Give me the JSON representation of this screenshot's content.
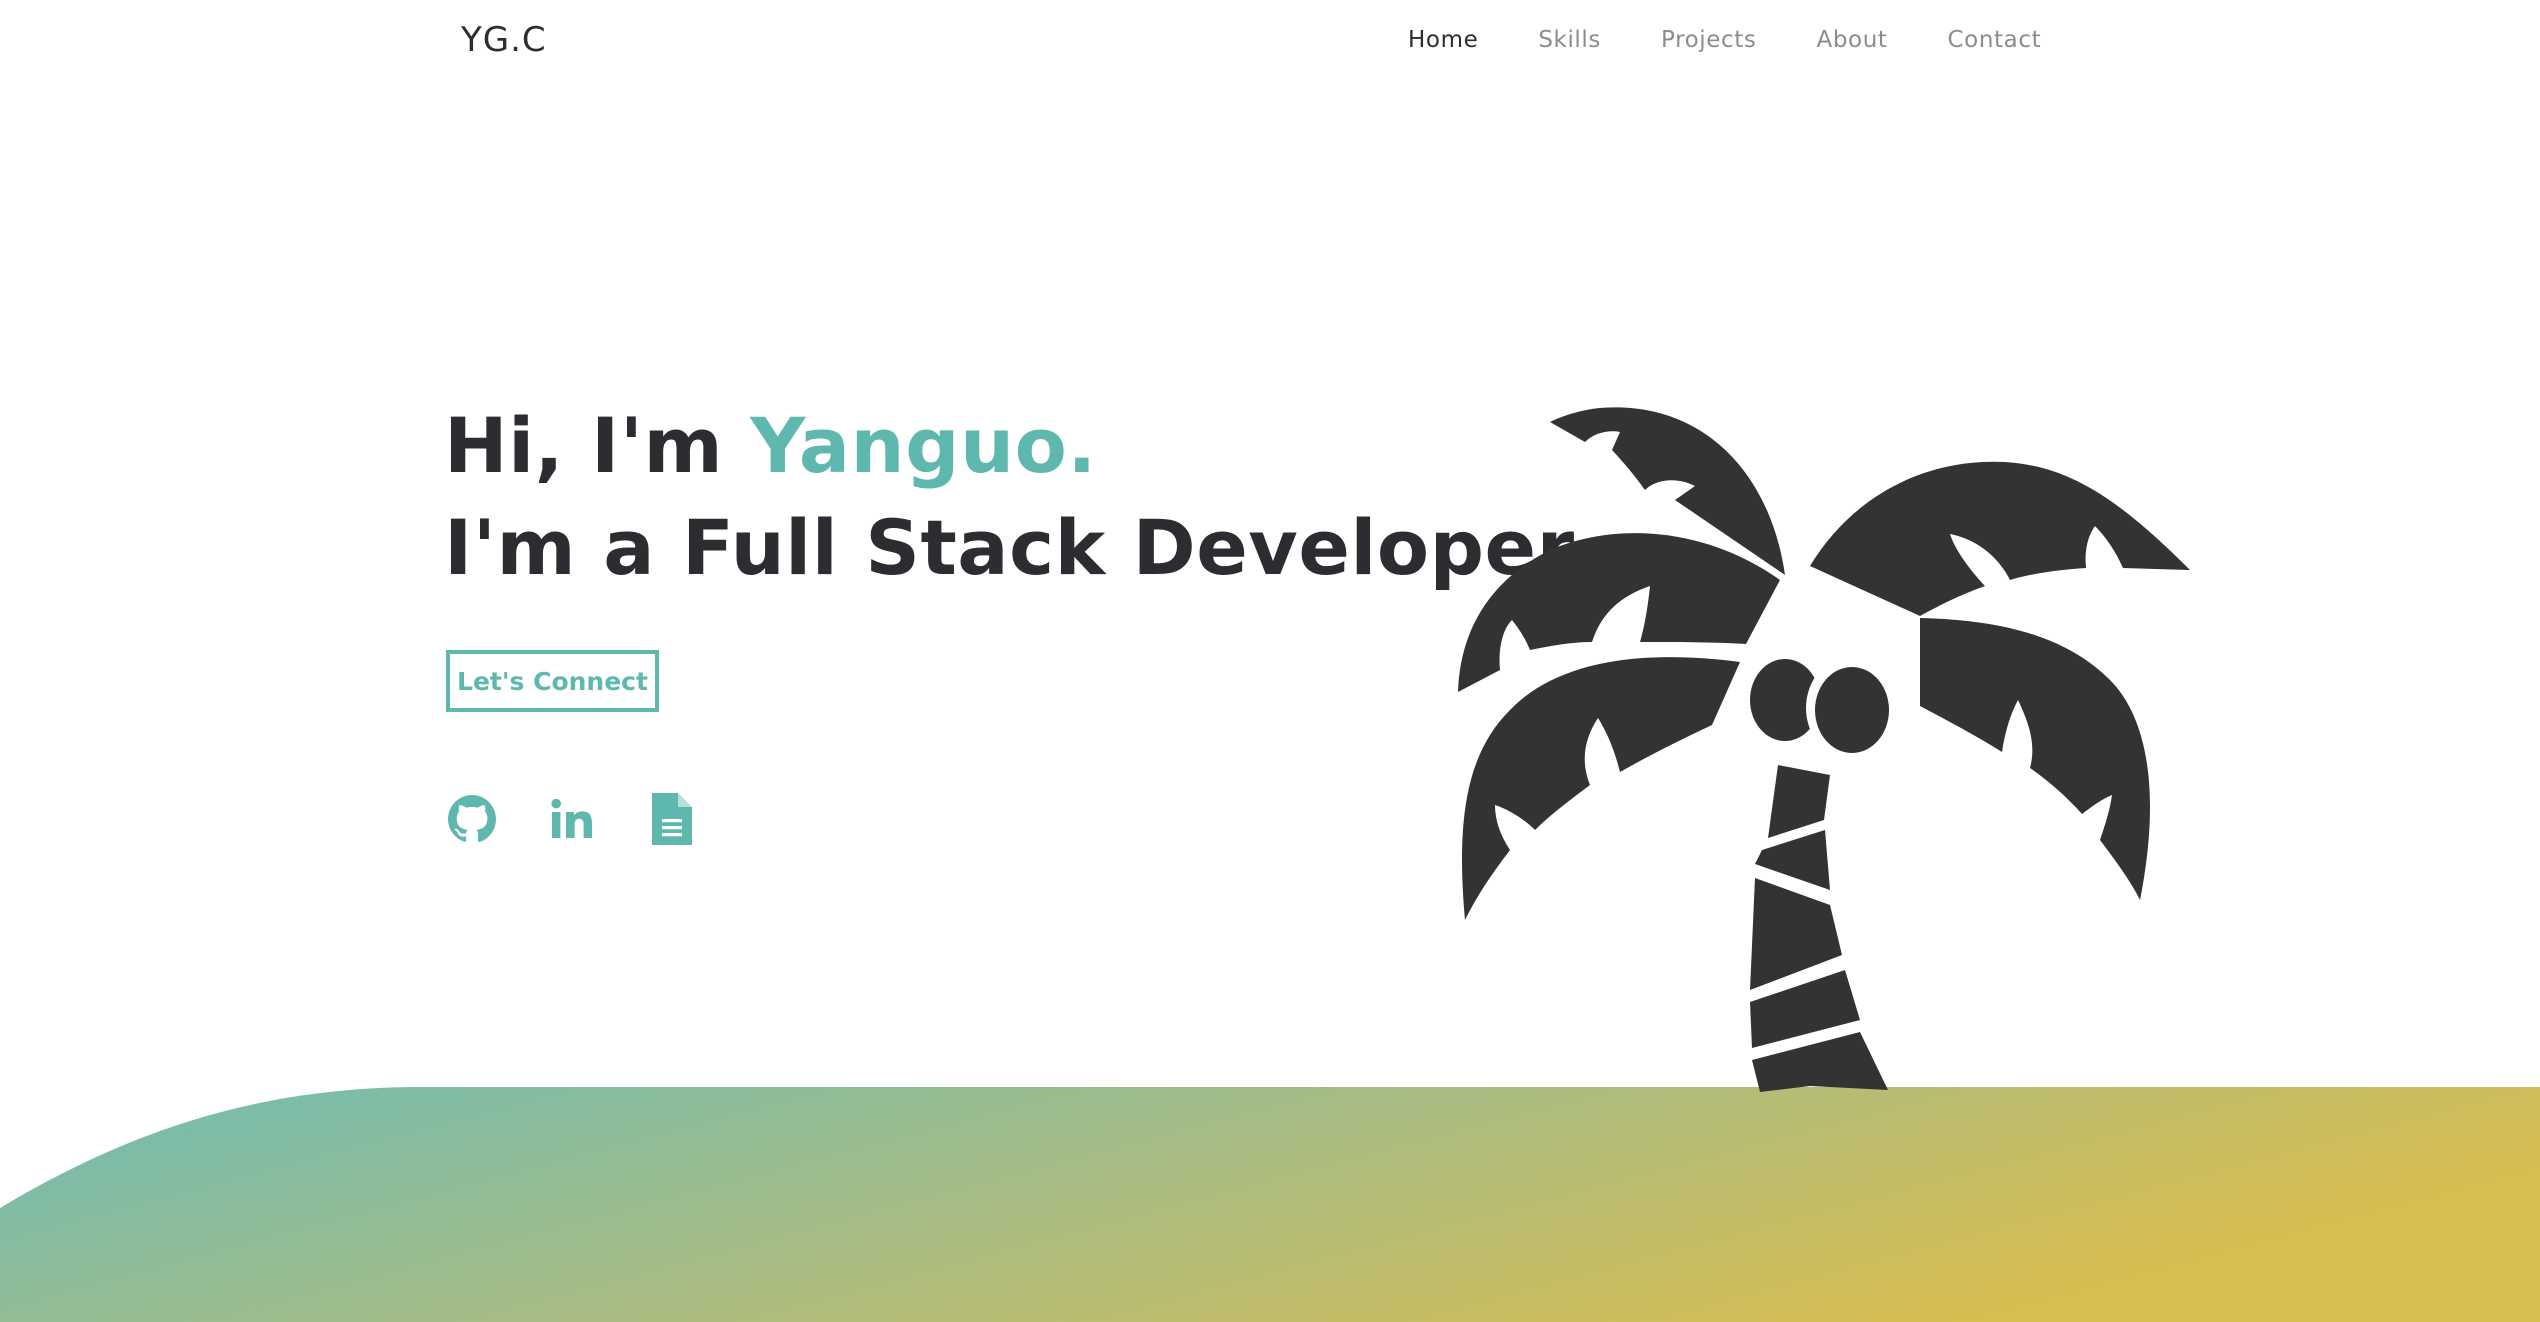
{
  "nav": {
    "logo": "YG.C",
    "links": [
      {
        "label": "Home",
        "active": true
      },
      {
        "label": "Skills",
        "active": false
      },
      {
        "label": "Projects",
        "active": false
      },
      {
        "label": "About",
        "active": false
      },
      {
        "label": "Contact",
        "active": false
      }
    ]
  },
  "hero": {
    "greeting": "Hi, I'm ",
    "name": "Yanguo.",
    "tagline": "I'm a Full Stack Developer.",
    "cta_label": "Let's Connect"
  },
  "socials": [
    {
      "icon": "github-icon"
    },
    {
      "icon": "linkedin-icon"
    },
    {
      "icon": "resume-document-icon"
    }
  ],
  "colors": {
    "accent": "#5fb8ad",
    "text": "#2b2d31",
    "nav_inactive": "#8a8c90",
    "palm": "#333333",
    "ground_gradient_start": "#6fbcb3",
    "ground_gradient_end": "#d8bd50"
  }
}
